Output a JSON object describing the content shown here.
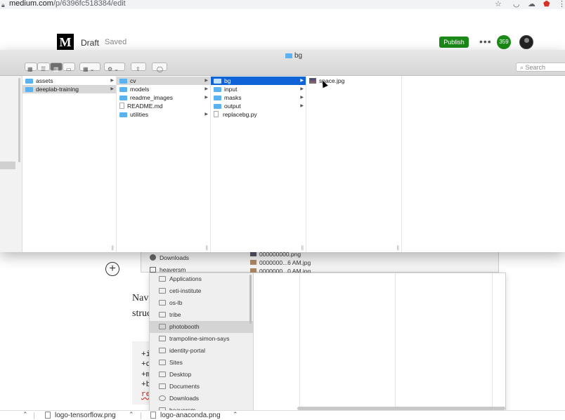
{
  "browser": {
    "url_domain": "medium.com",
    "url_path": "/p/6396fc518384/edit",
    "lock_icon": "lock-icon",
    "icons": [
      "star-icon",
      "pocket-icon",
      "cloud-icon",
      "shield-icon"
    ]
  },
  "medium": {
    "logo": "M",
    "status": "Draft",
    "saved": "Saved",
    "publish": "Publish",
    "more": "•••",
    "notifications": "359",
    "add_symbol": "+",
    "text_lines": [
      "Navi",
      "struc"
    ],
    "code_lines": [
      "+i",
      "+o",
      "+m",
      "+b",
      "re"
    ],
    "brand_color": "#1a8917"
  },
  "finder": {
    "title": "bg",
    "search_placeholder": "Search",
    "columns": [
      {
        "items": [
          {
            "label": "assets",
            "type": "folder",
            "arrow": true
          },
          {
            "label": "deeplab-training",
            "type": "folder",
            "arrow": true,
            "selected": "gray"
          }
        ]
      },
      {
        "items": [
          {
            "label": "cv",
            "type": "folder",
            "arrow": true,
            "selected": "gray"
          },
          {
            "label": "models",
            "type": "folder",
            "arrow": true
          },
          {
            "label": "readme_images",
            "type": "folder",
            "arrow": true
          },
          {
            "label": "README.md",
            "type": "doc"
          },
          {
            "label": "utilities",
            "type": "folder",
            "arrow": true
          }
        ]
      },
      {
        "items": [
          {
            "label": "bg",
            "type": "folder",
            "arrow": true,
            "selected": "blue"
          },
          {
            "label": "input",
            "type": "folder",
            "arrow": true
          },
          {
            "label": "masks",
            "type": "folder",
            "arrow": true
          },
          {
            "label": "output",
            "type": "folder",
            "arrow": true
          },
          {
            "label": "replacebg.py",
            "type": "doc"
          }
        ]
      },
      {
        "items": [
          {
            "label": "space.jpg",
            "type": "image"
          }
        ]
      }
    ]
  },
  "back_finder": {
    "top_items": [
      "Downloads",
      "heaversm"
    ],
    "files": [
      "000000000.png",
      "0000000...6 AM.jpg",
      "0000000...0 AM.jpg"
    ],
    "sidebar": [
      {
        "label": "Applications",
        "icon": "applications-icon"
      },
      {
        "label": "ceti-institute",
        "icon": "folder-icon"
      },
      {
        "label": "os-lb",
        "icon": "file-icon"
      },
      {
        "label": "tribe",
        "icon": "file-icon"
      },
      {
        "label": "photobooth",
        "icon": "folder-icon",
        "selected": true
      },
      {
        "label": "trampoline-simon-says",
        "icon": "folder-icon"
      },
      {
        "label": "identity-portal",
        "icon": "folder-icon"
      },
      {
        "label": "Sites",
        "icon": "folder-icon"
      },
      {
        "label": "Desktop",
        "icon": "folder-icon"
      },
      {
        "label": "Documents",
        "icon": "documents-icon"
      },
      {
        "label": "Downloads",
        "icon": "downloads-icon"
      },
      {
        "label": "heaversm",
        "icon": "home-icon"
      }
    ]
  },
  "downloads": [
    {
      "label": "logo-tensorflow.png"
    },
    {
      "label": "logo-anaconda.png"
    }
  ]
}
